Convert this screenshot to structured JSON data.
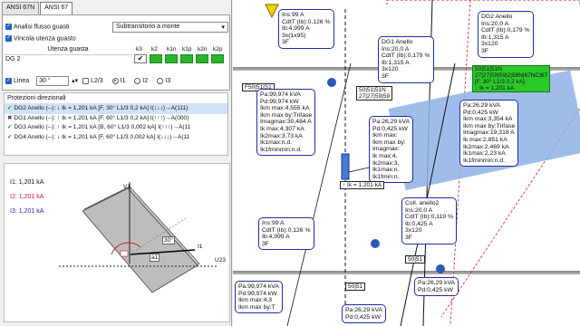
{
  "tabs": [
    "ANSI 67N",
    "ANSI 67"
  ],
  "options": {
    "analisi": "Analisi flusso guasti",
    "vincola": "Vincola utenza guasto",
    "mode": "Subtransitorio a monte"
  },
  "utenza": {
    "header": "Utenza guasta",
    "name": "DG 2",
    "cols": [
      "k3",
      "k2",
      "k1n",
      "k1p",
      "k2n",
      "k2p"
    ]
  },
  "linea": {
    "label": "Linea",
    "angle": "30 °",
    "l23": "L2/3",
    "i1": "I1",
    "i2": "I2",
    "i3": "I3"
  },
  "protezioni": {
    "title": "Protezioni direzionali",
    "rows": [
      "DG2 Anello (--): ↓ Ik = 1,201 kA [F, 30° L1/3 0,2 kA] I(↓↓↓)→A(111)",
      "DG1 Anello (--): ↑ Ik = 1,201 kA [F, 60° L1/3 0,2 kA] I(↑↑↑)→A(000)",
      "DG3 Anello (--): ↑ Ik = 1,201 kA [B, 60° L1/3 0,002 kA] I(↑↑↑)→A(11",
      "DG4 Anello (--): ↓ Ik = 1,201 kA [F, 60° L1/3 0,002 kA] I(↓↓↓)→A(11"
    ]
  },
  "vector": {
    "i1": "I1: 1,201 kA",
    "i2": "I2: 1,201 kA",
    "i3": "I3: 1,201 kA",
    "v1": "V1",
    "lbl_i1": "I1",
    "u23": "U23",
    "a30": "30°",
    "a1": "a1"
  },
  "diagram": {
    "dg2_right": [
      "DG2 Anello",
      "Ins:20,0 A",
      "CdtT (Ib):0,179 %",
      "Ib:1,315 A",
      "3x120",
      "3F"
    ],
    "dg1": [
      "DG1 Anello",
      "Ins:20,0 A",
      "CdtT (Ib):0,179 %",
      "Ib:1,315 A",
      "3x120",
      "3F"
    ],
    "left1": [
      "Ins:99 A",
      "CdtT (Ib):0,126 %",
      "Ib:4,999 A",
      "3x(1x95)",
      "3F"
    ],
    "left2": [
      "Pa:99,974 kVA",
      "Pd:99,974 kW",
      "Ikm max:4,555 kA",
      "Ikm max by:Trifase",
      "Imagmax:30,484 A",
      "Ik max:4,307 kA",
      "Ik2max:3,73 kA",
      "Ik1max:n.d.",
      "Ik1fminmin:n.d."
    ],
    "mid": [
      "Pa:26,29 kVA",
      "Pd:0,425 kW",
      "Ikm max:",
      "Ikm max by:",
      "Imagmax:",
      "Ik max:4,",
      "Ik2max:3,",
      "Ik1max:n.",
      "Ik1fmin:n."
    ],
    "right2": [
      "Pa:26,29 kVA",
      "Pd:0,425 kW",
      "Ikm max:3,354 kA",
      "Ikm max by:Trifase",
      "Imagmax:19,318 A",
      "Ik max:2,851 kA",
      "Ik2max:2,469 kA",
      "Ik1max:2,23 kA",
      "Ik1fminmin:n.d."
    ],
    "col2": [
      "Coll. anello2",
      "Ins:20,0 A",
      "CdtT (Ib):0,119 %",
      "Ib:0,425 A",
      "3x120",
      "3F"
    ],
    "left3": [
      "Ins:99 A",
      "CdtT (Ib):0,126 %",
      "Ib:4,999 A",
      "3F"
    ],
    "left4": [
      "Pa:99,974 kVA",
      "Pd:99,974 kW",
      "Ikm max:4,3",
      "Ikm max by:T"
    ],
    "bot_mid": [
      "Pa:26,29 kVA",
      "Pd:0,425 kW"
    ],
    "bot_right": [
      "Pa:26,29 kVA",
      "Pd:0,425 kW"
    ],
    "tag_top": "50|51|51N",
    "tag_green": [
      "50|51|51N",
      "27|27|59|59|2|59N|67NC|67",
      "[F, 30° L1/3 0,2 kA]",
      "↓ Ik = 1,201 kA"
    ],
    "tag_mid": [
      "50|51|51N",
      "[F, 60° L1/3 0,2 kA]",
      "↑ Ik = 1,201 kA"
    ],
    "tag_small": [
      "50|51",
      "27|27|59|59"
    ],
    "tag_5051": "50|51",
    "tag_5051b": "50|51",
    "tag_l": "F50|51|S1",
    "qs": "QS",
    "ok": "OK"
  },
  "colors": {
    "green": "#2bb52b",
    "blue": "#1f2fa0",
    "shade": "#8fb2e6",
    "red": "#d02020"
  }
}
